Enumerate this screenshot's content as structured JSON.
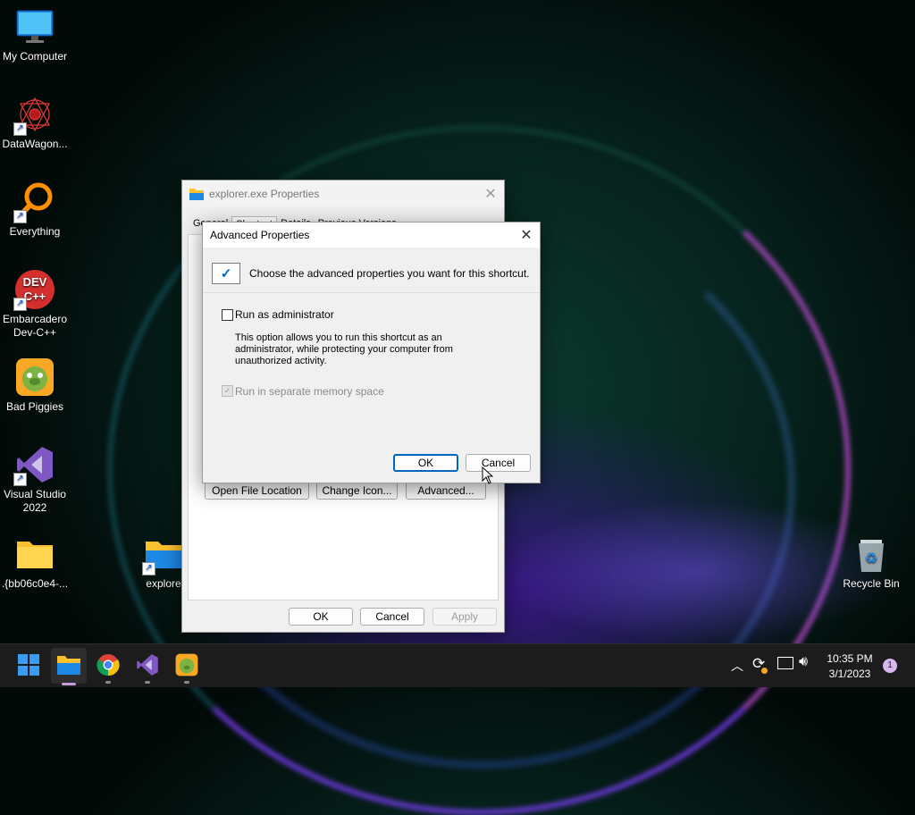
{
  "desktop": {
    "icons": [
      {
        "label": "My Computer"
      },
      {
        "label": "DataWagon..."
      },
      {
        "label": "Everything"
      },
      {
        "label": "Embarcadero Dev-C++"
      },
      {
        "label": "Bad Piggies"
      },
      {
        "label": "Visual Studio 2022"
      },
      {
        "label": ".{bb06c0e4-..."
      },
      {
        "label": "explore"
      },
      {
        "label": "Recycle Bin"
      }
    ],
    "devcpp_logo_text": "DEV C++"
  },
  "properties_window": {
    "title": "explorer.exe Properties",
    "tabs": [
      "General",
      "Shortcut",
      "Details",
      "Previous Versions"
    ],
    "buttons": {
      "open_file_location": "Open File Location",
      "change_icon": "Change Icon...",
      "advanced": "Advanced..."
    },
    "footer": {
      "ok": "OK",
      "cancel": "Cancel",
      "apply": "Apply"
    }
  },
  "advanced_dialog": {
    "title": "Advanced Properties",
    "header_text": "Choose the advanced properties you want for this shortcut.",
    "run_as_admin": {
      "label": "Run as administrator",
      "checked": false
    },
    "description": "This option allows you to run this shortcut as an administrator, while protecting your computer from unauthorized activity.",
    "separate_memory": {
      "label": "Run in separate memory space",
      "checked": true,
      "disabled": true
    },
    "ok_label": "OK",
    "cancel_label": "Cancel"
  },
  "taskbar": {
    "time": "10:35 PM",
    "date": "3/1/2023",
    "notification_count": "1"
  },
  "colors": {
    "accent": "#0067c0",
    "taskbar": "#1c1c1c"
  }
}
